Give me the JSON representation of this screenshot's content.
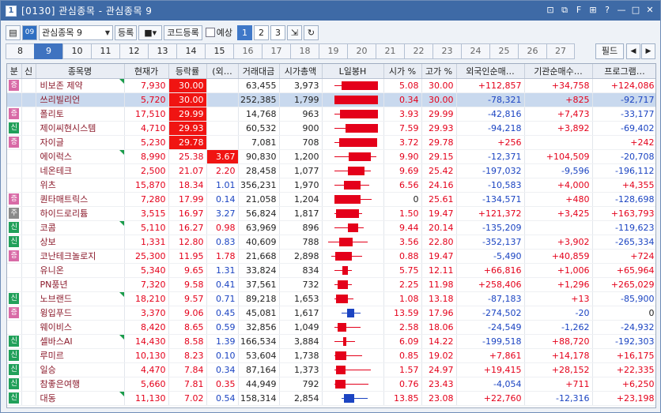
{
  "title": "[0130] 관심종목 - 관심종목 9",
  "title_icon": "1",
  "toolbar": {
    "icon1": "📋",
    "icon2": "09",
    "group_select": "관심종목 9",
    "register": "등록",
    "code_register": "코드등록",
    "reserve_label": "예상",
    "pages": [
      "1",
      "2",
      "3"
    ],
    "selected_page": "1"
  },
  "tabs": [
    "8",
    "9",
    "10",
    "11",
    "12",
    "13",
    "14",
    "15",
    "16",
    "17",
    "18",
    "19",
    "20",
    "21",
    "22",
    "23",
    "24",
    "25",
    "26",
    "27"
  ],
  "tabs_dark": [
    "8",
    "10",
    "11",
    "12",
    "13",
    "14",
    "15"
  ],
  "selected_tab": "9",
  "filter_label": "필드",
  "columns": [
    "분",
    "신",
    "종목명",
    "현재가",
    "등락률",
    "(외…",
    "거래대금",
    "시가총액",
    "L일봉H",
    "시가 %",
    "고가 %",
    "외국인순매…",
    "기관순매수…",
    "프로그램…"
  ],
  "colors": {
    "up": "#e4001a",
    "down": "#1b44c2",
    "highlight": "#f01412",
    "flag": "#1a9c4a",
    "badge_pink": "#d86aa6",
    "badge_green": "#21a05a",
    "badge_gray": "#8a8a8a",
    "selected_row": "#c9d9ee"
  },
  "rows": [
    {
      "b": "증",
      "bc": "pink",
      "s": "",
      "name": "비보존 제약",
      "nc": "",
      "flag": true,
      "price": "7,930",
      "rate": "30.00",
      "rh": true,
      "rc": "up",
      "frn": "",
      "frc": "",
      "amt": "63,455",
      "cap": "3,973",
      "open": "5.08",
      "oc": "up",
      "high": "30.00",
      "hc": "up",
      "f": "+112,857",
      "fc": "up",
      "i": "+34,758",
      "ic": "up",
      "p": "+124,086",
      "pc": "up",
      "cd": {
        "o": 5.08,
        "h": 30.0,
        "l": 0,
        "c": 30.0
      }
    },
    {
      "b": "",
      "bc": "",
      "s": "",
      "name": "쓰리빌리언",
      "nc": "",
      "flag": false,
      "price": "5,720",
      "rate": "30.00",
      "rh": true,
      "rc": "up",
      "frn": "",
      "frc": "",
      "amt": "252,385",
      "cap": "1,799",
      "open": "0.34",
      "oc": "up",
      "high": "30.00",
      "hc": "up",
      "f": "-78,321",
      "fc": "dn",
      "i": "+825",
      "ic": "up",
      "p": "-92,717",
      "pc": "dn",
      "cd": {
        "o": 0.34,
        "h": 30.0,
        "l": 0,
        "c": 30.0
      },
      "sel": true
    },
    {
      "b": "증",
      "bc": "pink",
      "s": "",
      "name": "폴리토",
      "nc": "",
      "flag": false,
      "price": "17,510",
      "rate": "29.99",
      "rh": true,
      "rc": "up",
      "frn": "",
      "frc": "",
      "amt": "14,768",
      "cap": "963",
      "open": "3.93",
      "oc": "up",
      "high": "29.99",
      "hc": "up",
      "f": "-42,816",
      "fc": "dn",
      "i": "+7,473",
      "ic": "up",
      "p": "-33,177",
      "pc": "dn",
      "cd": {
        "o": 3.93,
        "h": 29.99,
        "l": 0,
        "c": 29.99
      }
    },
    {
      "b": "신",
      "bc": "green",
      "s": "",
      "name": "제이씨현시스템",
      "nc": "",
      "flag": false,
      "price": "4,710",
      "rate": "29.93",
      "rh": true,
      "rc": "up",
      "frn": "",
      "frc": "",
      "amt": "60,532",
      "cap": "900",
      "open": "7.59",
      "oc": "up",
      "high": "29.93",
      "hc": "up",
      "f": "-94,218",
      "fc": "dn",
      "i": "+3,892",
      "ic": "up",
      "p": "-69,402",
      "pc": "dn",
      "cd": {
        "o": 7.59,
        "h": 29.93,
        "l": 0,
        "c": 29.93
      }
    },
    {
      "b": "증",
      "bc": "pink",
      "s": "",
      "name": "자이글",
      "nc": "",
      "flag": false,
      "price": "5,230",
      "rate": "29.78",
      "rh": true,
      "rc": "up",
      "frn": "",
      "frc": "",
      "amt": "7,081",
      "cap": "708",
      "open": "3.72",
      "oc": "up",
      "high": "29.78",
      "hc": "up",
      "f": "+256",
      "fc": "up",
      "i": "",
      "ic": "",
      "p": "+242",
      "pc": "up",
      "cd": {
        "o": 3.72,
        "h": 29.78,
        "l": 0,
        "c": 29.78
      }
    },
    {
      "b": "",
      "bc": "",
      "s": "",
      "name": "에이럭스",
      "nc": "",
      "flag": true,
      "price": "8,990",
      "rate": "25.38",
      "rh": false,
      "rc": "up",
      "frn": "3.67",
      "frc": "hl",
      "amt": "90,830",
      "cap": "1,200",
      "open": "9.90",
      "oc": "up",
      "high": "29.15",
      "hc": "up",
      "f": "-12,371",
      "fc": "dn",
      "i": "+104,509",
      "ic": "up",
      "p": "-20,708",
      "pc": "dn",
      "cd": {
        "o": 9.9,
        "h": 29.15,
        "l": 0,
        "c": 25.38
      }
    },
    {
      "b": "",
      "bc": "",
      "s": "",
      "name": "네온테크",
      "nc": "",
      "flag": false,
      "price": "2,500",
      "rate": "21.07",
      "rh": false,
      "rc": "up",
      "frn": "2.20",
      "frc": "up",
      "amt": "28,458",
      "cap": "1,077",
      "open": "9.69",
      "oc": "up",
      "high": "25.42",
      "hc": "up",
      "f": "-197,032",
      "fc": "dn",
      "i": "-9,596",
      "ic": "dn",
      "p": "-196,112",
      "pc": "dn",
      "cd": {
        "o": 9.69,
        "h": 25.42,
        "l": 0,
        "c": 21.07
      }
    },
    {
      "b": "",
      "bc": "",
      "s": "",
      "name": "위츠",
      "nc": "",
      "flag": false,
      "price": "15,870",
      "rate": "18.34",
      "rh": false,
      "rc": "up",
      "frn": "1.01",
      "frc": "dn",
      "amt": "356,231",
      "cap": "1,970",
      "open": "6.56",
      "oc": "up",
      "high": "24.16",
      "hc": "up",
      "f": "-10,583",
      "fc": "dn",
      "i": "+4,000",
      "ic": "up",
      "p": "+4,355",
      "pc": "up",
      "cd": {
        "o": 6.56,
        "h": 24.16,
        "l": 0,
        "c": 18.34
      }
    },
    {
      "b": "증",
      "bc": "pink",
      "s": "",
      "name": "퀀타매트릭스",
      "nc": "",
      "flag": false,
      "price": "7,280",
      "rate": "17.99",
      "rh": false,
      "rc": "up",
      "frn": "0.14",
      "frc": "dn",
      "amt": "21,058",
      "cap": "1,204",
      "open": "0",
      "oc": "blk",
      "high": "25.61",
      "hc": "up",
      "f": "-134,571",
      "fc": "dn",
      "i": "+480",
      "ic": "up",
      "p": "-128,698",
      "pc": "dn",
      "cd": {
        "o": 0,
        "h": 25.61,
        "l": 0,
        "c": 17.99
      }
    },
    {
      "b": "주",
      "bc": "gray",
      "s": "",
      "name": "하이드로리튬",
      "nc": "",
      "flag": false,
      "price": "3,515",
      "rate": "16.97",
      "rh": false,
      "rc": "up",
      "frn": "3.27",
      "frc": "dn",
      "amt": "56,824",
      "cap": "1,817",
      "open": "1.50",
      "oc": "up",
      "high": "19.47",
      "hc": "up",
      "f": "+121,372",
      "fc": "up",
      "i": "+3,425",
      "ic": "up",
      "p": "+163,793",
      "pc": "up",
      "cd": {
        "o": 1.5,
        "h": 19.47,
        "l": 0,
        "c": 16.97
      }
    },
    {
      "b": "신",
      "bc": "green",
      "s": "",
      "name": "코콤",
      "nc": "",
      "flag": true,
      "price": "5,110",
      "rate": "16.27",
      "rh": false,
      "rc": "up",
      "frn": "0.98",
      "frc": "up",
      "amt": "63,969",
      "cap": "896",
      "open": "9.44",
      "oc": "up",
      "high": "20.14",
      "hc": "up",
      "f": "-135,209",
      "fc": "dn",
      "i": "",
      "ic": "",
      "p": "-119,623",
      "pc": "dn",
      "cd": {
        "o": 9.44,
        "h": 20.14,
        "l": 0,
        "c": 16.27
      }
    },
    {
      "b": "신",
      "bc": "green",
      "s": "",
      "name": "상보",
      "nc": "",
      "flag": false,
      "price": "1,331",
      "rate": "12.80",
      "rh": false,
      "rc": "up",
      "frn": "0.83",
      "frc": "dn",
      "amt": "40,609",
      "cap": "788",
      "open": "3.56",
      "oc": "up",
      "high": "22.80",
      "hc": "up",
      "f": "-352,137",
      "fc": "dn",
      "i": "+3,902",
      "ic": "up",
      "p": "-265,334",
      "pc": "dn",
      "cd": {
        "o": 3.56,
        "h": 22.8,
        "l": -4,
        "c": 12.8
      }
    },
    {
      "b": "증",
      "bc": "pink",
      "s": "",
      "name": "코난테크놀로지",
      "nc": "",
      "flag": false,
      "price": "25,300",
      "rate": "11.95",
      "rh": false,
      "rc": "up",
      "frn": "1.78",
      "frc": "up",
      "amt": "21,668",
      "cap": "2,898",
      "open": "0.88",
      "oc": "up",
      "high": "19.47",
      "hc": "up",
      "f": "-5,490",
      "fc": "dn",
      "i": "+40,859",
      "ic": "up",
      "p": "+724",
      "pc": "up",
      "cd": {
        "o": 0.88,
        "h": 19.47,
        "l": -2,
        "c": 11.95
      }
    },
    {
      "b": "",
      "bc": "",
      "s": "",
      "name": "유니온",
      "nc": "",
      "flag": false,
      "price": "5,340",
      "rate": "9.65",
      "rh": false,
      "rc": "up",
      "frn": "1.31",
      "frc": "dn",
      "amt": "33,824",
      "cap": "834",
      "open": "5.75",
      "oc": "up",
      "high": "12.11",
      "hc": "up",
      "f": "+66,816",
      "fc": "up",
      "i": "+1,006",
      "ic": "up",
      "p": "+65,964",
      "pc": "up",
      "cd": {
        "o": 5.75,
        "h": 12.11,
        "l": 0,
        "c": 9.65
      }
    },
    {
      "b": "",
      "bc": "",
      "s": "",
      "name": "PN풍년",
      "nc": "",
      "flag": false,
      "price": "7,320",
      "rate": "9.58",
      "rh": false,
      "rc": "up",
      "frn": "0.41",
      "frc": "dn",
      "amt": "37,561",
      "cap": "732",
      "open": "2.25",
      "oc": "up",
      "high": "11.98",
      "hc": "up",
      "f": "+258,406",
      "fc": "up",
      "i": "+1,296",
      "ic": "up",
      "p": "+265,029",
      "pc": "up",
      "cd": {
        "o": 2.25,
        "h": 11.98,
        "l": 0,
        "c": 9.58
      }
    },
    {
      "b": "신",
      "bc": "green",
      "s": "",
      "name": "노브랜드",
      "nc": "",
      "flag": true,
      "price": "18,210",
      "rate": "9.57",
      "rh": false,
      "rc": "up",
      "frn": "0.71",
      "frc": "dn",
      "amt": "89,218",
      "cap": "1,653",
      "open": "1.08",
      "oc": "up",
      "high": "13.18",
      "hc": "up",
      "f": "-87,183",
      "fc": "dn",
      "i": "+13",
      "ic": "up",
      "p": "-85,900",
      "pc": "dn",
      "cd": {
        "o": 1.08,
        "h": 13.18,
        "l": 0,
        "c": 9.57
      }
    },
    {
      "b": "증",
      "bc": "pink",
      "s": "",
      "name": "윙입푸드",
      "nc": "",
      "flag": false,
      "price": "3,370",
      "rate": "9.06",
      "rh": false,
      "rc": "up",
      "frn": "0.45",
      "frc": "dn",
      "amt": "45,081",
      "cap": "1,617",
      "open": "13.59",
      "oc": "up",
      "high": "17.96",
      "hc": "up",
      "f": "-274,502",
      "fc": "dn",
      "i": "-20",
      "ic": "dn",
      "p": "0",
      "pc": "blk",
      "cd": {
        "o": 13.59,
        "h": 17.96,
        "l": 5,
        "c": 9.06
      }
    },
    {
      "b": "",
      "bc": "",
      "s": "",
      "name": "웨이비스",
      "nc": "",
      "flag": false,
      "price": "8,420",
      "rate": "8.65",
      "rh": false,
      "rc": "up",
      "frn": "0.59",
      "frc": "dn",
      "amt": "32,856",
      "cap": "1,049",
      "open": "2.58",
      "oc": "up",
      "high": "18.06",
      "hc": "up",
      "f": "-24,549",
      "fc": "dn",
      "i": "-1,262",
      "ic": "dn",
      "p": "-24,932",
      "pc": "dn",
      "cd": {
        "o": 2.58,
        "h": 18.06,
        "l": 0,
        "c": 8.65
      }
    },
    {
      "b": "신",
      "bc": "green",
      "s": "",
      "name": "셀바스AI",
      "nc": "",
      "flag": true,
      "price": "14,430",
      "rate": "8.58",
      "rh": false,
      "rc": "up",
      "frn": "1.39",
      "frc": "dn",
      "amt": "166,534",
      "cap": "3,884",
      "open": "6.09",
      "oc": "up",
      "high": "14.22",
      "hc": "up",
      "f": "-199,518",
      "fc": "dn",
      "i": "+88,720",
      "ic": "up",
      "p": "-192,303",
      "pc": "dn",
      "cd": {
        "o": 6.09,
        "h": 14.22,
        "l": 0,
        "c": 8.58
      }
    },
    {
      "b": "신",
      "bc": "green",
      "s": "",
      "name": "루미르",
      "nc": "",
      "flag": false,
      "price": "10,130",
      "rate": "8.23",
      "rh": false,
      "rc": "up",
      "frn": "0.10",
      "frc": "dn",
      "amt": "53,604",
      "cap": "1,738",
      "open": "0.85",
      "oc": "up",
      "high": "19.02",
      "hc": "up",
      "f": "+7,861",
      "fc": "up",
      "i": "+14,178",
      "ic": "up",
      "p": "+16,175",
      "pc": "up",
      "cd": {
        "o": 0.85,
        "h": 19.02,
        "l": 0,
        "c": 8.23
      }
    },
    {
      "b": "신",
      "bc": "green",
      "s": "",
      "name": "일승",
      "nc": "",
      "flag": false,
      "price": "4,470",
      "rate": "7.84",
      "rh": false,
      "rc": "up",
      "frn": "0.34",
      "frc": "dn",
      "amt": "87,164",
      "cap": "1,373",
      "open": "1.57",
      "oc": "up",
      "high": "24.97",
      "hc": "up",
      "f": "+19,415",
      "fc": "up",
      "i": "+28,152",
      "ic": "up",
      "p": "+22,335",
      "pc": "up",
      "cd": {
        "o": 1.57,
        "h": 24.97,
        "l": 0,
        "c": 7.84
      }
    },
    {
      "b": "신",
      "bc": "green",
      "s": "",
      "name": "참좋은여행",
      "nc": "",
      "flag": false,
      "price": "5,660",
      "rate": "7.81",
      "rh": false,
      "rc": "up",
      "frn": "0.35",
      "frc": "up",
      "amt": "44,949",
      "cap": "792",
      "open": "0.76",
      "oc": "up",
      "high": "23.43",
      "hc": "up",
      "f": "-4,054",
      "fc": "dn",
      "i": "+711",
      "ic": "up",
      "p": "+6,250",
      "pc": "up",
      "cd": {
        "o": 0.76,
        "h": 23.43,
        "l": 0,
        "c": 7.81
      }
    },
    {
      "b": "신",
      "bc": "green",
      "s": "",
      "name": "대동",
      "nc": "",
      "flag": true,
      "price": "11,130",
      "rate": "7.02",
      "rh": false,
      "rc": "up",
      "frn": "0.54",
      "frc": "dn",
      "amt": "158,314",
      "cap": "2,854",
      "open": "13.85",
      "oc": "up",
      "high": "23.08",
      "hc": "up",
      "f": "+22,760",
      "fc": "up",
      "i": "-12,316",
      "ic": "dn",
      "p": "+23,198",
      "pc": "up",
      "cd": {
        "o": 13.85,
        "h": 23.08,
        "l": 5,
        "c": 7.02
      }
    }
  ]
}
